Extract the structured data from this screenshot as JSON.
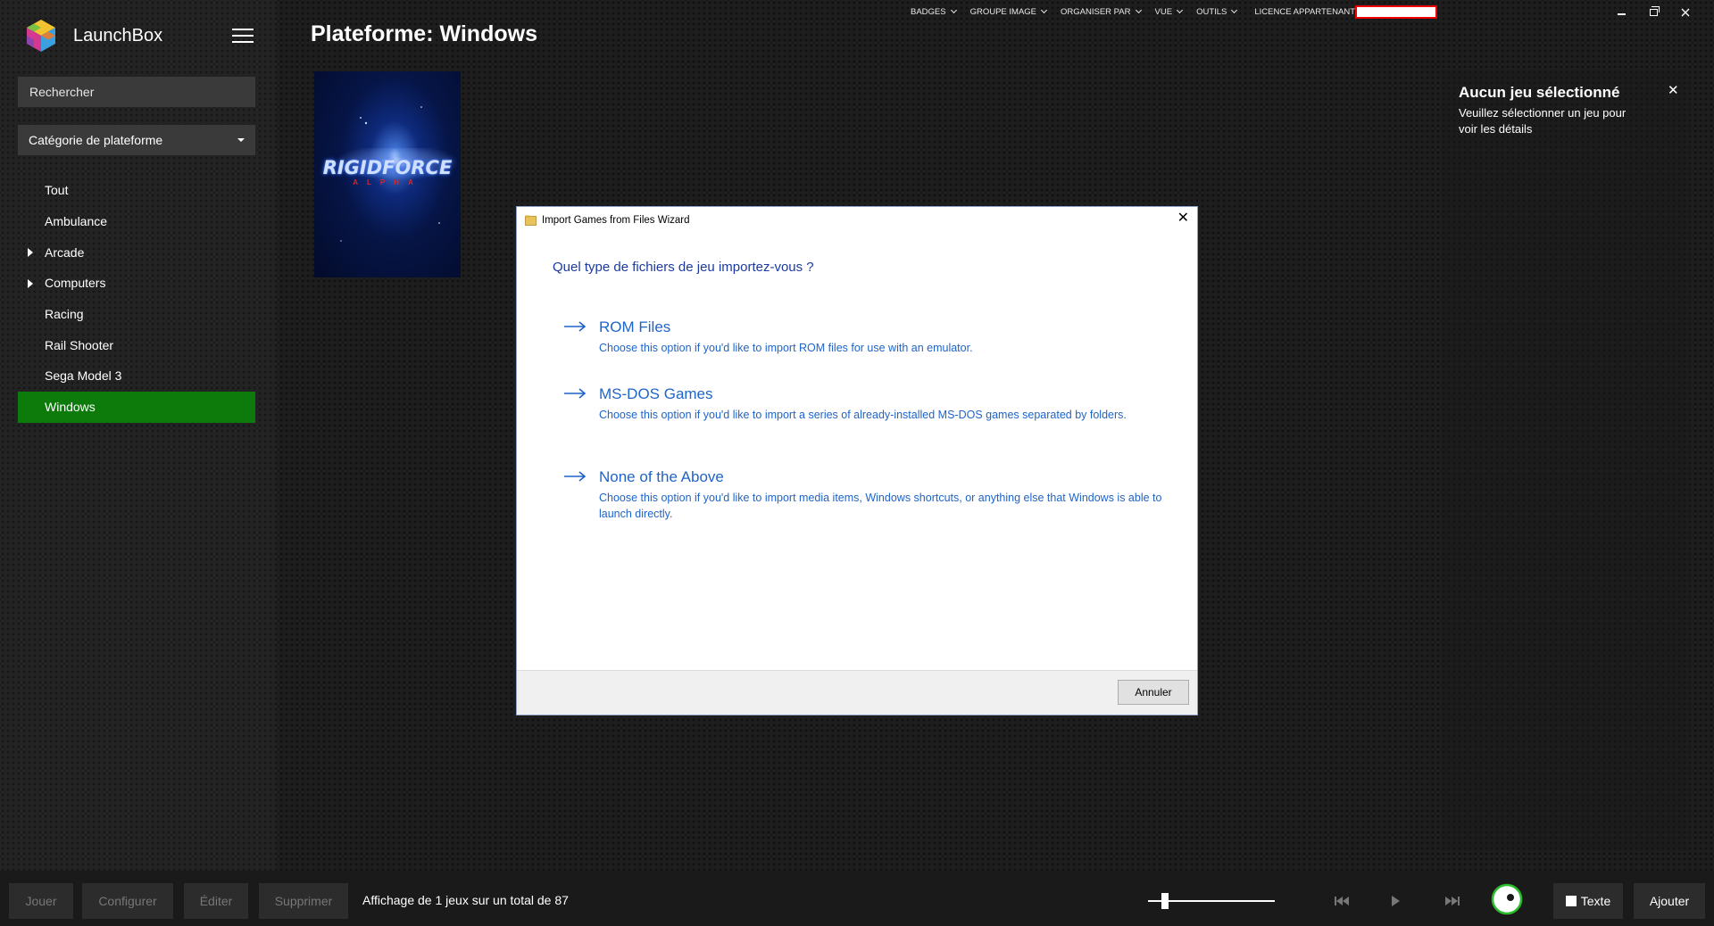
{
  "app": {
    "name": "LaunchBox"
  },
  "sidebar": {
    "search_placeholder": "Rechercher",
    "category_label": "Catégorie de plateforme",
    "items": [
      {
        "label": "Tout",
        "expandable": false,
        "active": false
      },
      {
        "label": "Ambulance",
        "expandable": false,
        "active": false
      },
      {
        "label": "Arcade",
        "expandable": true,
        "active": false
      },
      {
        "label": "Computers",
        "expandable": true,
        "active": false
      },
      {
        "label": "Racing",
        "expandable": false,
        "active": false
      },
      {
        "label": "Rail Shooter",
        "expandable": false,
        "active": false
      },
      {
        "label": "Sega Model 3",
        "expandable": false,
        "active": false
      },
      {
        "label": "Windows",
        "expandable": false,
        "active": true
      }
    ]
  },
  "header": {
    "title": "Plateforme: Windows",
    "menu": [
      "BADGES",
      "GROUPE IMAGE",
      "ORGANISER PAR",
      "VUE",
      "OUTILS"
    ],
    "license_label": "LICENCE APPARTENANT"
  },
  "game_tile": {
    "logo_text": "RIGIDFORCE",
    "logo_sub": "ALPHA"
  },
  "details": {
    "title": "Aucun jeu sélectionné",
    "text": "Veuillez sélectionner un jeu pour voir les détails",
    "close": "✕"
  },
  "dialog": {
    "title": "Import Games from Files Wizard",
    "question": "Quel type de fichiers de jeu importez-vous ?",
    "options": [
      {
        "title": "ROM Files",
        "description": "Choose this option if you'd like to import ROM files for use with an emulator."
      },
      {
        "title": "MS-DOS Games",
        "description": "Choose this option if you'd like to import a series of already-installed MS-DOS games separated by folders."
      },
      {
        "title": "None of the Above",
        "description": "Choose this option if you'd like to import media items, Windows shortcuts, or anything else that Windows is able to launch directly."
      }
    ],
    "cancel_label": "Annuler",
    "close": "✕"
  },
  "bottom_bar": {
    "play_label": "Jouer",
    "configure_label": "Configurer",
    "edit_label": "Éditer",
    "delete_label": "Supprimer",
    "status": "Affichage de 1 jeux sur un total de 87",
    "text_label": "Texte",
    "add_label": "Ajouter"
  },
  "colors": {
    "active_green": "#0c7b0c",
    "dialog_link_blue": "#1f64c9",
    "question_blue": "#1b3aa0"
  }
}
